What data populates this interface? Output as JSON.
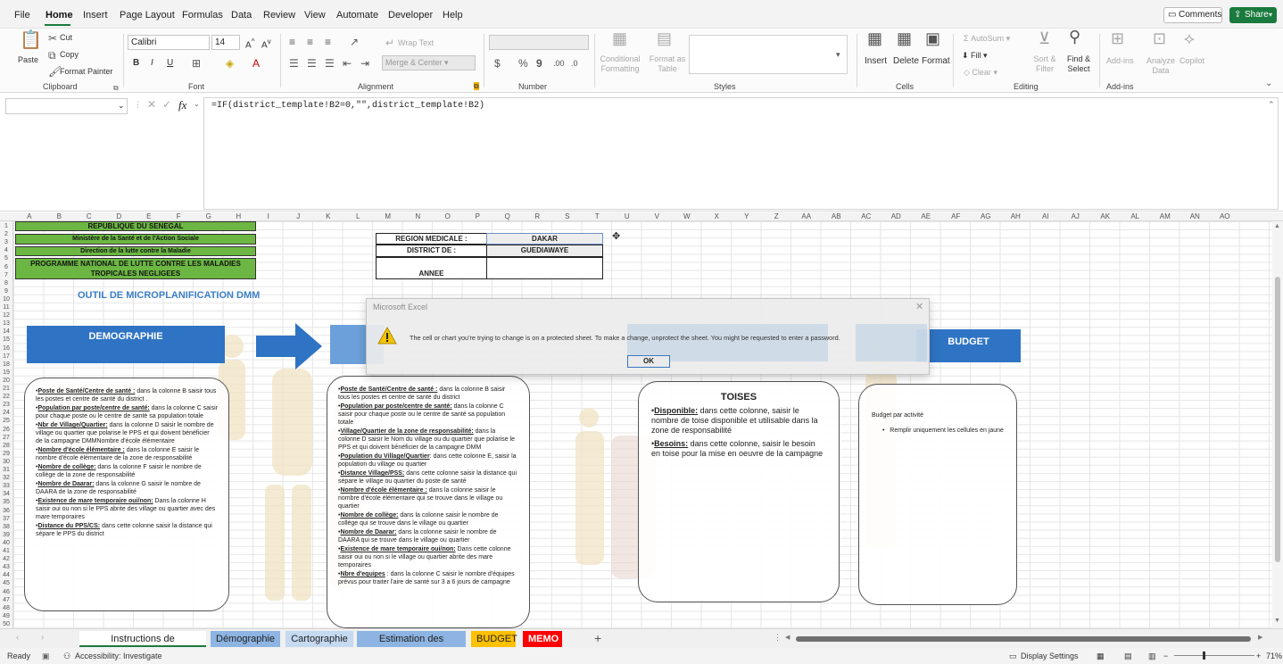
{
  "menu": {
    "tabs": [
      "File",
      "Home",
      "Insert",
      "Page Layout",
      "Formulas",
      "Data",
      "Review",
      "View",
      "Automate",
      "Developer",
      "Help"
    ],
    "comments_label": "Comments",
    "share_label": "Share"
  },
  "ribbon": {
    "clipboard": {
      "label": "Clipboard",
      "paste": "Paste",
      "cut": "Cut",
      "copy": "Copy",
      "format_painter": "Format Painter"
    },
    "font": {
      "label": "Font",
      "name": "Calibri",
      "size": "14",
      "bold": "B",
      "italic": "I",
      "underline": "U"
    },
    "alignment": {
      "label": "Alignment",
      "wrap": "Wrap Text",
      "merge": "Merge & Center"
    },
    "number": {
      "label": "Number"
    },
    "styles": {
      "label": "Styles",
      "conditional": "Conditional Formatting",
      "format_table": "Format as Table"
    },
    "cells": {
      "label": "Cells",
      "insert": "Insert",
      "delete": "Delete",
      "format": "Format"
    },
    "editing": {
      "label": "Editing",
      "autosum": "AutoSum",
      "fill": "Fill",
      "clear": "Clear",
      "sort": "Sort & Filter",
      "find": "Find & Select"
    },
    "addins": {
      "label": "Add-ins",
      "addins": "Add-ins",
      "analyze": "Analyze Data",
      "copilot": "Copilot"
    }
  },
  "formula": {
    "fx": "fx",
    "text": "=IF(district_template!B2=0,\"\",district_template!B2)"
  },
  "columns": [
    "A",
    "B",
    "C",
    "D",
    "E",
    "F",
    "G",
    "H",
    "I",
    "J",
    "K",
    "L",
    "M",
    "N",
    "O",
    "P",
    "Q",
    "R",
    "S",
    "T",
    "U",
    "V",
    "W",
    "X",
    "Y",
    "Z",
    "AA",
    "AB",
    "AC",
    "AD",
    "AE",
    "AF",
    "AG",
    "AH",
    "AI",
    "AJ",
    "AK",
    "AL",
    "AM",
    "AN",
    "AO"
  ],
  "sheet": {
    "headers": [
      "REPUBLIQUE DU SENEGAL",
      "Ministère de la Santé et de l'Action Sociale",
      "Direction de la lutte contre la Maladie",
      "PROGRAMME NATIONAL DE LUTTE CONTRE LES MALADIES TROPICALES NEGLIGEES"
    ],
    "info": {
      "region_label": "REGION MEDICALE :",
      "region_value": "DAKAR",
      "district_label": "DISTRICT DE :",
      "district_value": "GUEDIAWAYE",
      "annee_label": "ANNEE"
    },
    "tool_title": "OUTIL DE MICROPLANIFICATION DMM",
    "banners": {
      "demographie": "DEMOGRAPHIE",
      "budget": "BUDGET"
    },
    "card1": [
      {
        "k": "Poste de Santé/Centre de santé :",
        "v": " dans la colonne B saisir tous les postes et centre de santé du district ."
      },
      {
        "k": "Population par poste/centre de santé:",
        "v": " dans la colonne C saisir pour chaque poste ou le centre de santé sa population totale"
      },
      {
        "k": "Nbr de Village/Quartier:",
        "v": " dans la colonne D saisir le nombre de village ou quartier que polarise le PPS et qui doivent bénéficier de la campagne DMMNombre d'école élémentaire"
      },
      {
        "k": "Nombre d'école élémentaire :",
        "v": " dans la colonne E saisir le nombre d'école élémentaire de la zone de responsabilité"
      },
      {
        "k": "Nombre de collège:",
        "v": " dans la colonne F saisir le nombre de collège de la zone de responsabilité"
      },
      {
        "k": "Nombre de Daarar:",
        "v": " dans la colonne G saisir le nombre de DAARA de la zone de responsabilité"
      },
      {
        "k": "Existence de mare temporaire oui/non:",
        "v": " Dans la colonne H saisir oui ou non si le PPS abrite des village ou quartier avec des mare temporaires"
      },
      {
        "k": "Distance du PPS/CS:",
        "v": " dans cette colonne saisir la distance qui sépare le PPS du district"
      }
    ],
    "card2": [
      {
        "k": "Poste de Santé/Centre de santé :",
        "v": " dans la colonne B saisir tous les postes et centre de santé du district"
      },
      {
        "k": "Population par poste/centre de santé:",
        "v": " dans la colonne C saisir pour chaque poste ou le centre de santé sa population totale"
      },
      {
        "k": "Village/Quartier de la zone de responsabilité:",
        "v": " dans la colonne D saisir le Nom du village ou du quartier que polarise le PPS et qui doivent bénéficier de la campagne DMM"
      },
      {
        "k": "Population du Village/Quartier",
        "v": ": dans cette colonne E, saisir la population du village ou quartier"
      },
      {
        "k": "Distance Village/PSS:",
        "v": " dans cette colonne saisir la distance qui sépare le village ou quartier du poste de santé"
      },
      {
        "k": "Nombre d'école élémentaire :",
        "v": " dans la colonne saisir le nombre d'école élémentaire qui se trouve dans le village ou quartier"
      },
      {
        "k": "Nombre de collège:",
        "v": " dans la colonne saisir le nombre de collège qui se trouve dans le village ou quartier"
      },
      {
        "k": "Nombre de Daarar:",
        "v": " dans la colonne saisir le nombre de DAARA qui se trouve dans le village ou quartier"
      },
      {
        "k": "Existence de mare temporaire oui/non:",
        "v": " Dans cette colonne saisir oui ou non si le village ou quartier abrite des mare temporaires"
      },
      {
        "k": "Nbre d'equipes",
        "v": " : dans la colonne C saisir le nombre d'équipes prévus pour traiter l'aire de santé sur 3 a 6 jours de campagne"
      }
    ],
    "toises": {
      "title": "TOISES",
      "items": [
        {
          "k": "Disponible:",
          "v": " dans cette colonne, saisir le nombre de toise disponible et utilisable dans la zone de responsabilité"
        },
        {
          "k": "Besoins:",
          "v": " dans cette colonne, saisir le besoin en toise pour la mise en oeuvre de la campagne"
        }
      ]
    },
    "budget_card": {
      "title": "Budget par activité",
      "item": "Remplir uniquement les cellules en jaune"
    }
  },
  "dialog": {
    "title": "Microsoft Excel",
    "message": "The cell or chart you're trying to change is on a protected sheet. To make a change, unprotect the sheet. You might be requested to enter a password.",
    "ok": "OK"
  },
  "tabs": [
    {
      "label": "Instructions de remplissage",
      "color": "#ffffff",
      "active": true
    },
    {
      "label": "Démographie",
      "color": "#8db4e2"
    },
    {
      "label": "Cartographie",
      "color": "#c5d9f1"
    },
    {
      "label": "Estimation des besoins",
      "color": "#8db4e2"
    },
    {
      "label": "BUDGET",
      "color": "#ffc000"
    },
    {
      "label": "MEMO",
      "color": "#ff0000"
    }
  ],
  "status": {
    "ready": "Ready",
    "accessibility": "Accessibility: Investigate",
    "display": "Display Settings",
    "zoom": "71%"
  }
}
